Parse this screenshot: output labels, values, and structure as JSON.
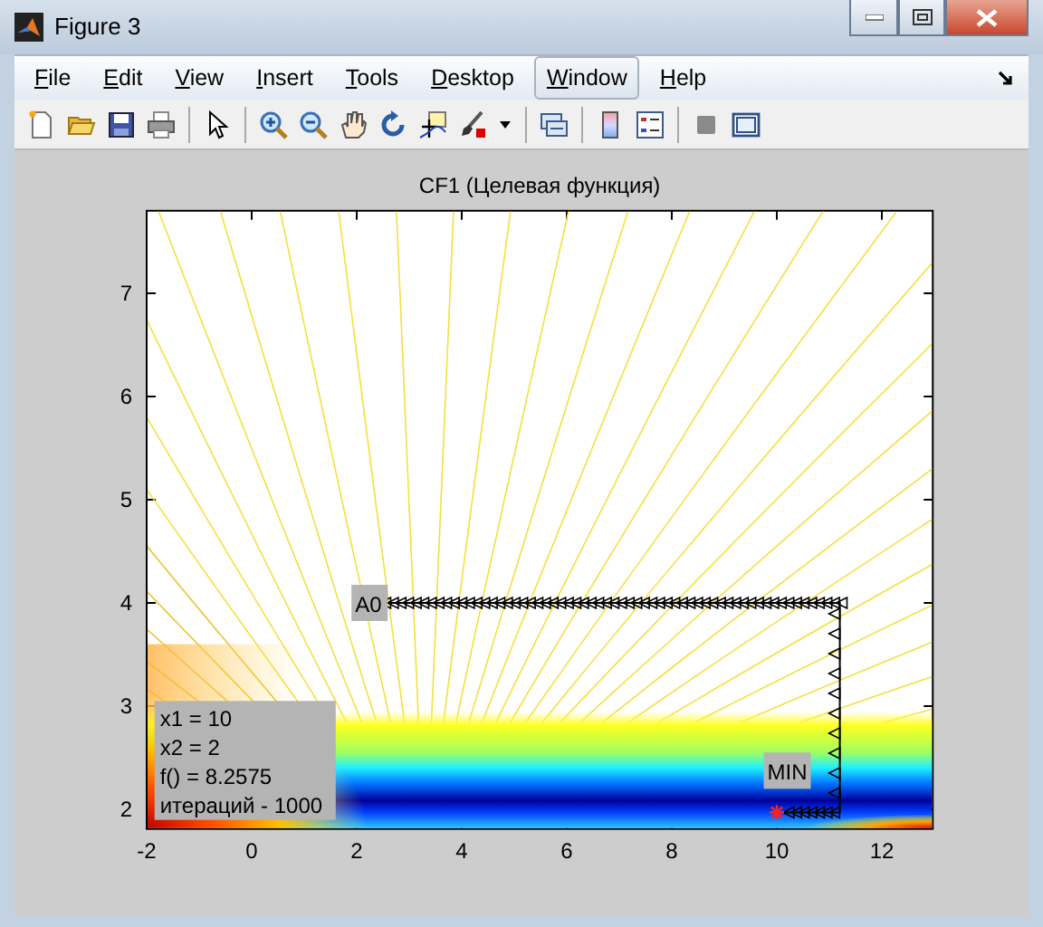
{
  "window": {
    "title": "Figure 3"
  },
  "menu": [
    {
      "label": "File",
      "selected": false
    },
    {
      "label": "Edit",
      "selected": false
    },
    {
      "label": "View",
      "selected": false
    },
    {
      "label": "Insert",
      "selected": false
    },
    {
      "label": "Tools",
      "selected": false
    },
    {
      "label": "Desktop",
      "selected": false
    },
    {
      "label": "Window",
      "selected": true
    },
    {
      "label": "Help",
      "selected": false
    }
  ],
  "plot": {
    "title": "CF1 (Целевая функция)",
    "xticks": [
      "-2",
      "0",
      "2",
      "4",
      "6",
      "8",
      "10",
      "12"
    ],
    "yticks": [
      "7",
      "6",
      "5",
      "4",
      "3",
      "2"
    ],
    "start_label": "A0",
    "min_label": "MIN",
    "info": [
      "x1 = 10",
      "x2 = 2",
      "f() = 8.2575",
      "итераций - 1000"
    ]
  }
}
